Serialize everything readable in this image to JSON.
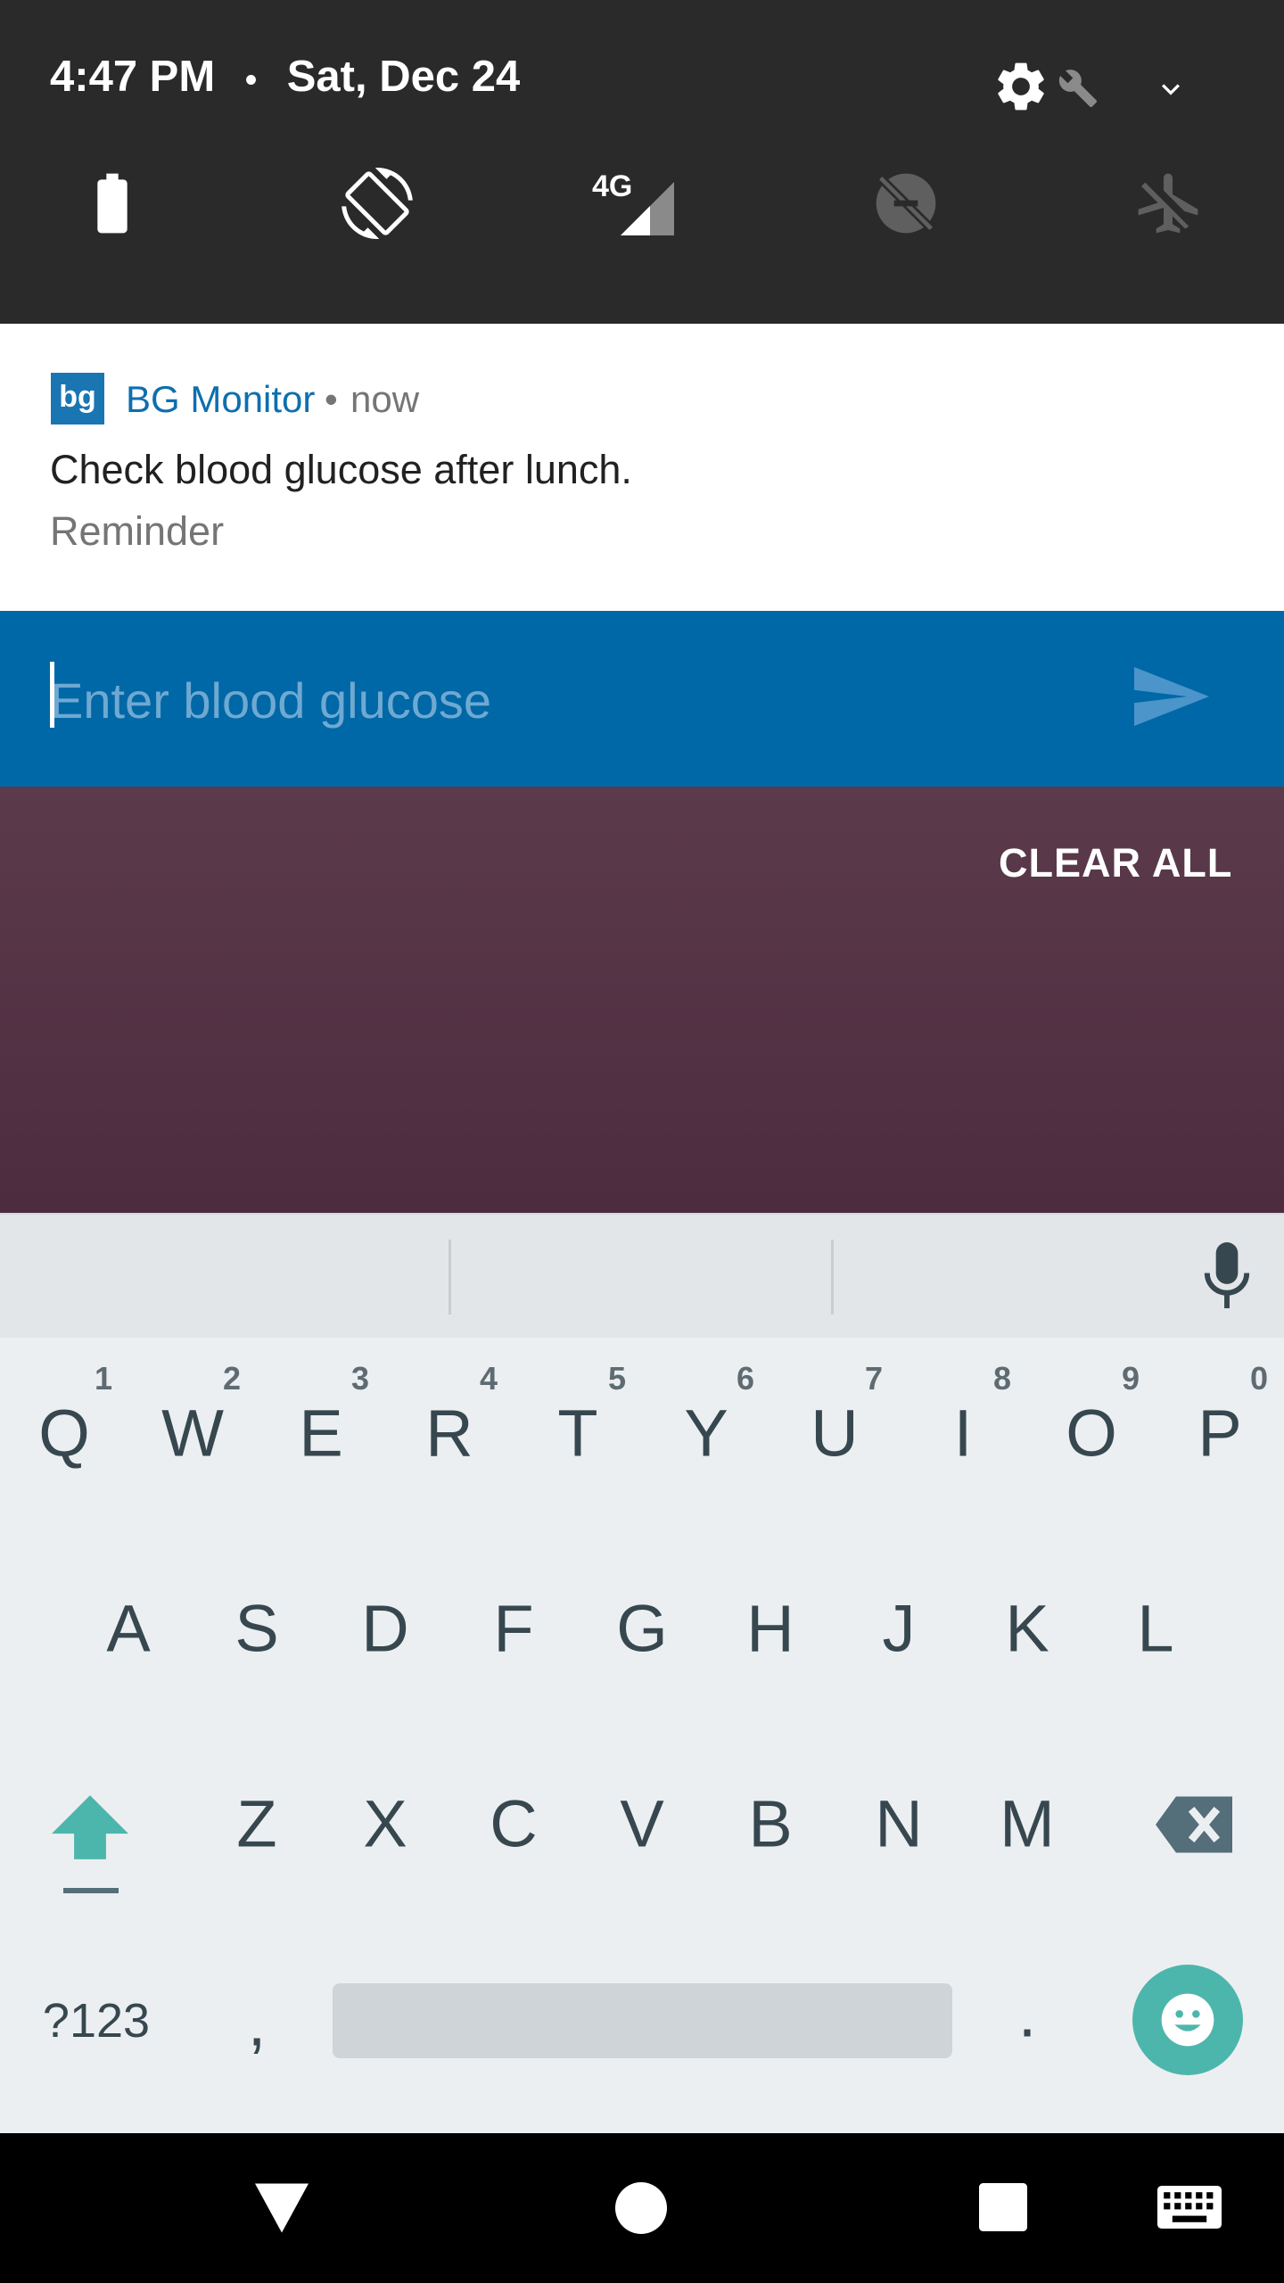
{
  "status_bar": {
    "time": "4:47 PM",
    "separator": "•",
    "date": "Sat, Dec 24"
  },
  "quick_settings": {
    "icons": [
      "settings-icon",
      "wrench-icon",
      "expand-chevron-icon",
      "battery-icon",
      "auto-rotate-icon",
      "signal-4g-icon",
      "data-saver-off-icon",
      "airplane-mode-off-icon"
    ],
    "network_label": "4G"
  },
  "notification": {
    "app_icon_text": "bg",
    "app_name": "BG Monitor",
    "separator": "•",
    "time": "now",
    "title": "Check blood glucose after lunch.",
    "subtitle": "Reminder",
    "reply_placeholder": "Enter blood glucose",
    "accent_color": "#0068a7"
  },
  "shade": {
    "clear_all_label": "CLEAR ALL"
  },
  "keyboard": {
    "row1": [
      {
        "key": "Q",
        "hint": "1"
      },
      {
        "key": "W",
        "hint": "2"
      },
      {
        "key": "E",
        "hint": "3"
      },
      {
        "key": "R",
        "hint": "4"
      },
      {
        "key": "T",
        "hint": "5"
      },
      {
        "key": "Y",
        "hint": "6"
      },
      {
        "key": "U",
        "hint": "7"
      },
      {
        "key": "I",
        "hint": "8"
      },
      {
        "key": "O",
        "hint": "9"
      },
      {
        "key": "P",
        "hint": "0"
      }
    ],
    "row2": [
      "A",
      "S",
      "D",
      "F",
      "G",
      "H",
      "J",
      "K",
      "L"
    ],
    "row3": [
      "Z",
      "X",
      "C",
      "V",
      "B",
      "N",
      "M"
    ],
    "symbols_label": "?123",
    "comma_label": ",",
    "period_label": ".",
    "accent_color": "#4db6ac"
  },
  "nav_bar": {
    "icons": [
      "back-icon",
      "home-icon",
      "recents-icon",
      "keyboard-switch-icon"
    ]
  }
}
